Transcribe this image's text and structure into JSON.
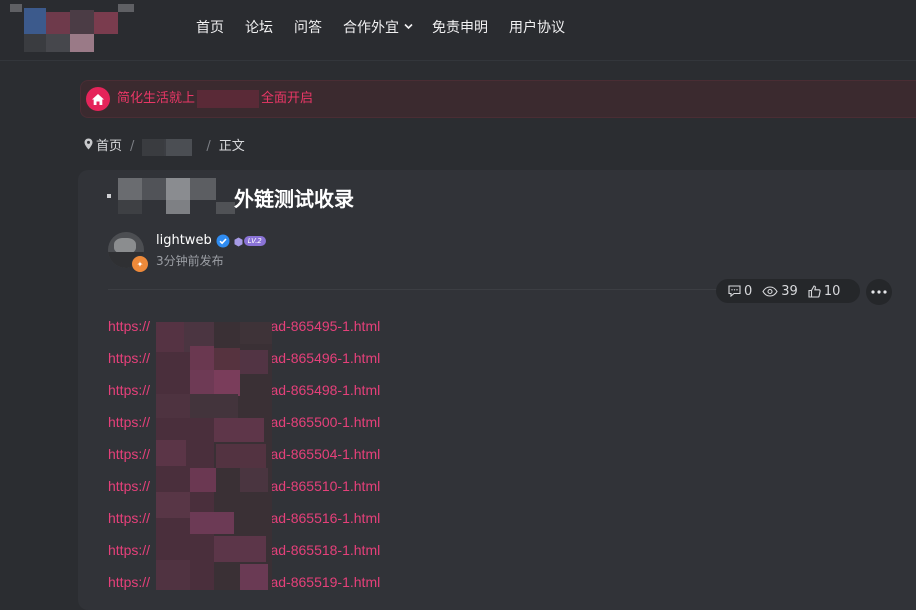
{
  "nav": {
    "items": [
      {
        "label": "首页"
      },
      {
        "label": "论坛"
      },
      {
        "label": "问答"
      },
      {
        "label": "合作外宜",
        "has_dropdown": true
      },
      {
        "label": "免责申明"
      },
      {
        "label": "用户协议"
      }
    ]
  },
  "notice": {
    "icon": "home-icon",
    "text_before": "简化生活就上",
    "text_after": "全面开启",
    "accent_color": "#e5245a"
  },
  "breadcrumb": {
    "home": "首页",
    "sep1": "/",
    "sep2": "/",
    "current": "正文"
  },
  "post": {
    "title_suffix": "外链测试收录",
    "author": "lightweb",
    "level_badge": "LV.2",
    "posted": "3分钟前发布",
    "stats": {
      "comments": "0",
      "views": "39",
      "likes": "10"
    }
  },
  "links": [
    {
      "prefix": "https://",
      "suffix": "read-865495-1.html"
    },
    {
      "prefix": "https://",
      "suffix": "read-865496-1.html"
    },
    {
      "prefix": "https://",
      "suffix": "read-865498-1.html"
    },
    {
      "prefix": "https://",
      "suffix": "read-865500-1.html"
    },
    {
      "prefix": "https://",
      "suffix": "read-865504-1.html"
    },
    {
      "prefix": "https://",
      "suffix": "read-865510-1.html"
    },
    {
      "prefix": "https://",
      "suffix": "read-865516-1.html"
    },
    {
      "prefix": "https://",
      "suffix": "read-865518-1.html"
    },
    {
      "prefix": "https://",
      "suffix": "read-865519-1.html"
    }
  ],
  "colors": {
    "link": "#e5407a",
    "background": "#2b2d31",
    "card": "#313338"
  }
}
